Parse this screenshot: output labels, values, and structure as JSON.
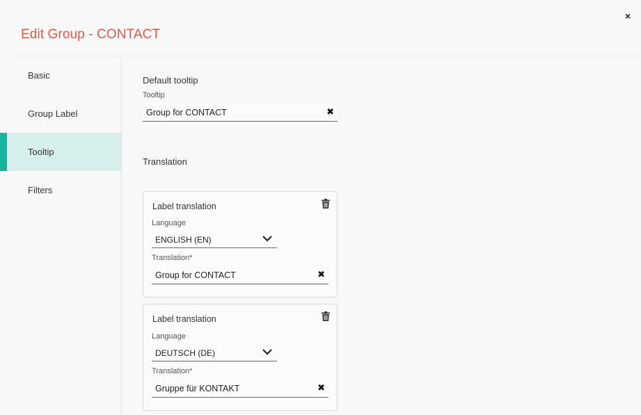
{
  "dialog": {
    "title": "Edit Group - CONTACT",
    "close_icon": "close-icon",
    "close_label": "×"
  },
  "colors": {
    "title": "#e05a48",
    "active_accent": "#17b39c",
    "active_bg": "#d6efec"
  },
  "sidebar": {
    "items": [
      {
        "label": "Basic",
        "active": false
      },
      {
        "label": "Group Label",
        "active": false
      },
      {
        "label": "Tooltip",
        "active": true
      },
      {
        "label": "Filters",
        "active": false
      }
    ]
  },
  "tooltip": {
    "section_title": "Default tooltip",
    "field_label": "Tooltip",
    "value": "Group for CONTACT",
    "clear_label": "✖"
  },
  "translation": {
    "section_title": "Translation",
    "cards": [
      {
        "title": "Label translation",
        "delete_icon": "trash-icon",
        "language_label": "Language",
        "language_value": "ENGLISH (EN)",
        "translation_label": "Translation*",
        "translation_value": "Group for CONTACT",
        "clear_label": "✖"
      },
      {
        "title": "Label translation",
        "delete_icon": "trash-icon",
        "language_label": "Language",
        "language_value": "DEUTSCH (DE)",
        "translation_label": "Translation*",
        "translation_value": "Gruppe für KONTAKT",
        "clear_label": "✖"
      }
    ]
  }
}
